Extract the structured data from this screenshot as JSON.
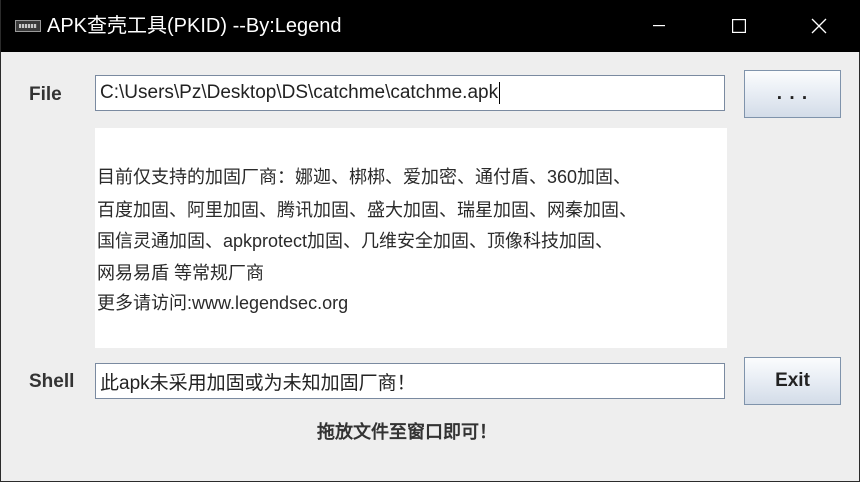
{
  "window": {
    "title": "APK查壳工具(PKID) --By:Legend",
    "icon": "app-icon",
    "controls": [
      "minimize-icon",
      "maximize-icon",
      "close-icon"
    ]
  },
  "file_row": {
    "label": "File",
    "path_value": "C:\\Users\\Pz\\Desktop\\DS\\catchme\\catchme.apk",
    "browse_label": ". . ."
  },
  "info": {
    "lines": [
      "目前仅支持的加固厂商：娜迦、梆梆、爱加密、通付盾、360加固、",
      "百度加固、阿里加固、腾讯加固、盛大加固、瑞星加固、网秦加固、",
      "国信灵通加固、apkprotect加固、几维安全加固、顶像科技加固、",
      "网易易盾 等常规厂商",
      "更多请访问:www.legendsec.org"
    ]
  },
  "shell_row": {
    "label": "Shell",
    "result_value": "此apk未采用加固或为未知加固厂商！",
    "exit_label": "Exit"
  },
  "hint": "拖放文件至窗口即可！",
  "colors": {
    "titlebar": "#000000",
    "window_bg": "#eeeeee",
    "panel_bg": "#ffffff",
    "field_border": "#7a8aa0"
  }
}
